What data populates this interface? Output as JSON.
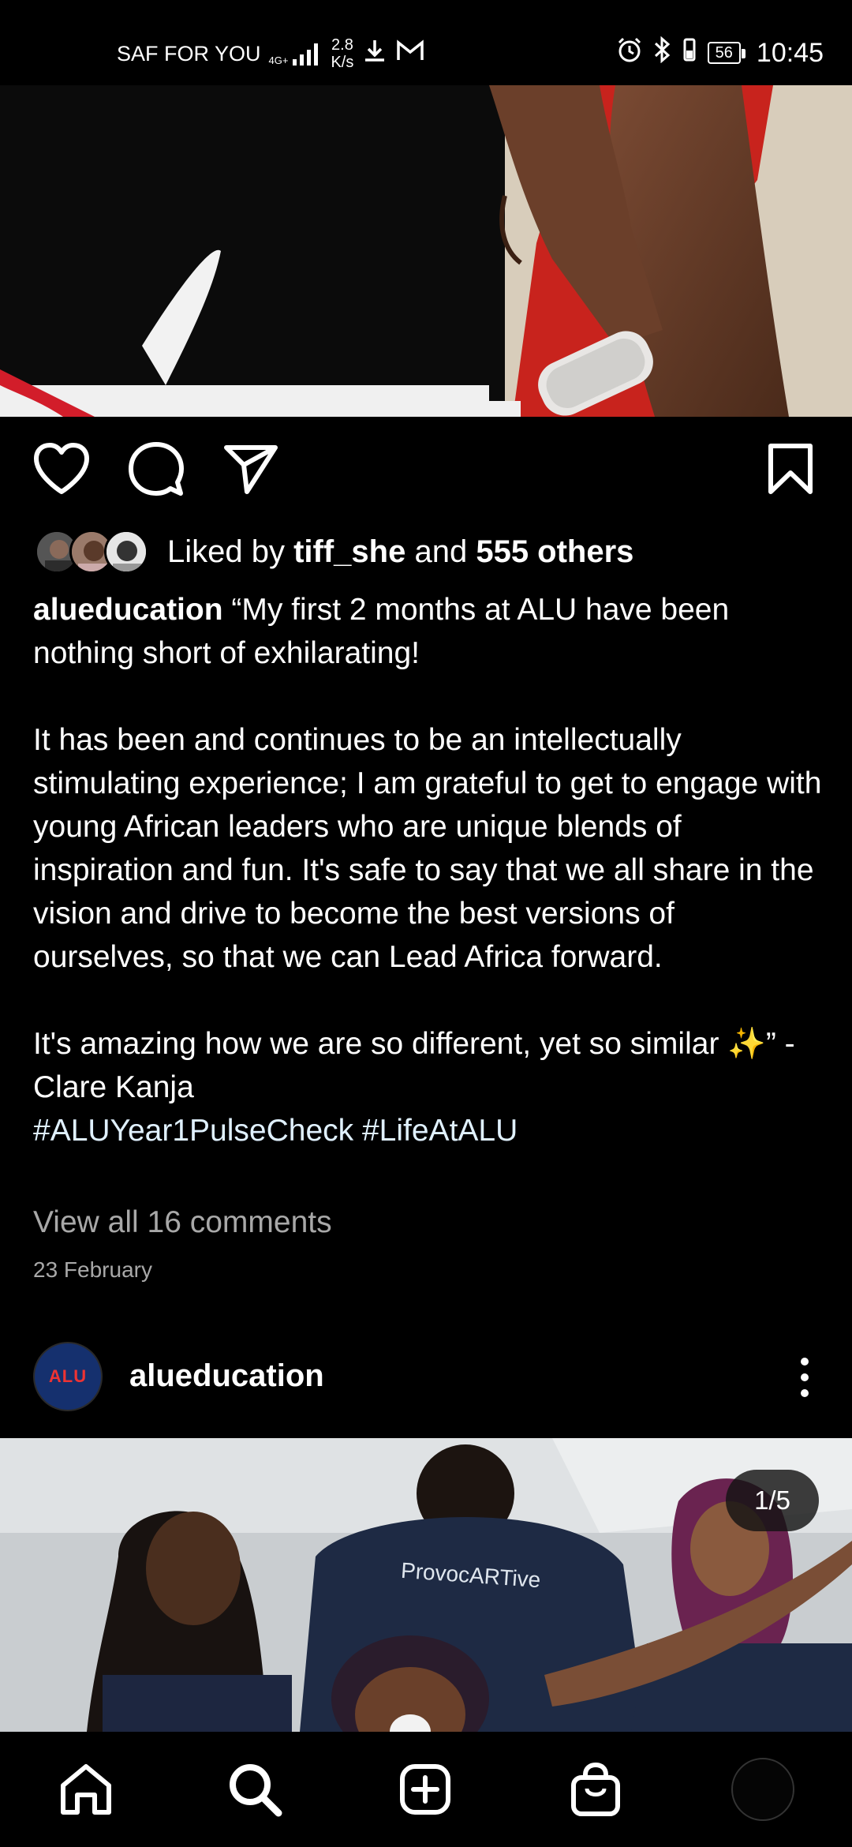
{
  "status_bar": {
    "carrier": "SAF FOR YOU",
    "network": "4G+",
    "speed_value": "2.8",
    "speed_unit": "K/s",
    "battery": "56",
    "time": "10:45"
  },
  "post": {
    "liked_by_prefix": "Liked by ",
    "liked_by_user": "tiff_she",
    "liked_by_mid": " and ",
    "liked_by_count": "555 others",
    "caption_user": "alueducation",
    "caption_p1": "“My first 2 months at ALU have been nothing short of exhilarating!",
    "caption_p2": "It has been and continues to be an intellectually stimulating experience; I am grateful to get to engage with young African leaders who are unique blends of inspiration and fun. It's safe to say that we all share in the vision and drive to become the best versions of ourselves, so that we can Lead Africa forward.",
    "caption_p3": "It's amazing how we are so different, yet so similar ✨” -Clare Kanja",
    "hashtags": "#ALUYear1PulseCheck #LifeAtALU",
    "view_comments": "View all 16 comments",
    "date": "23 February"
  },
  "next_post": {
    "avatar_text": "ALU",
    "username": "alueducation",
    "counter": "1/5",
    "shirt_text": "ProvocARTive"
  },
  "icons": {
    "like": "heart-icon",
    "comment": "comment-icon",
    "share": "send-icon",
    "save": "bookmark-icon",
    "more": "more-vertical-icon",
    "home": "home-icon",
    "search": "search-icon",
    "create": "add-post-icon",
    "shop": "shop-bag-icon"
  }
}
